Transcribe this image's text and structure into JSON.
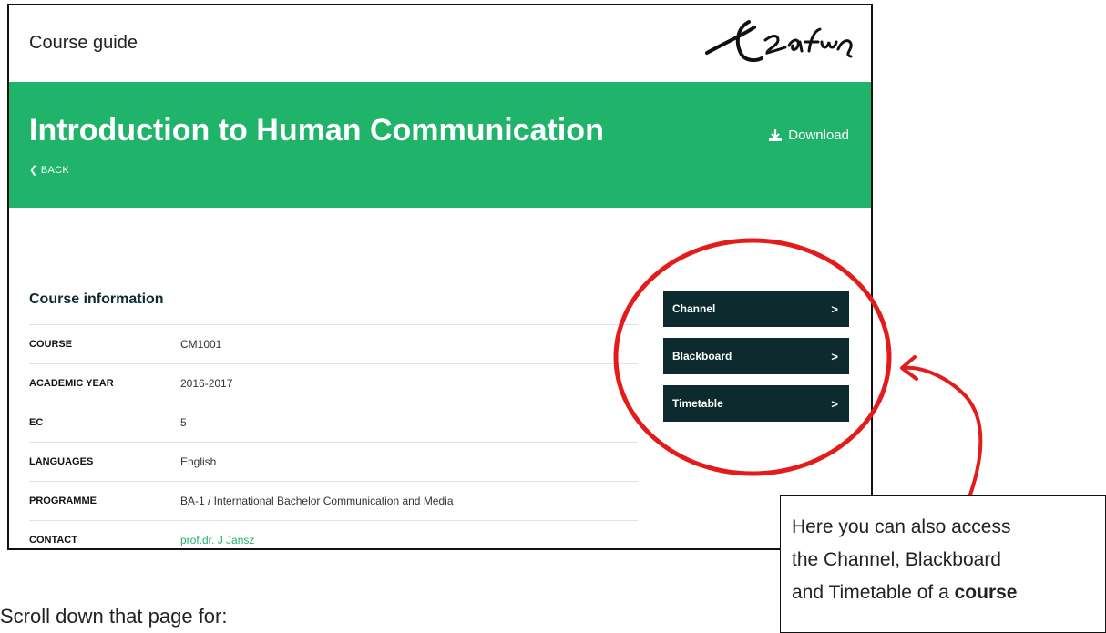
{
  "header": {
    "site_title": "Course guide",
    "logo_text": "Erasmus"
  },
  "hero": {
    "title": "Introduction to Human Communication",
    "back_label": "BACK",
    "download_label": "Download"
  },
  "course_info": {
    "title": "Course information",
    "rows": [
      {
        "label": "COURSE",
        "value": "CM1001"
      },
      {
        "label": "ACADEMIC YEAR",
        "value": "2016-2017"
      },
      {
        "label": "EC",
        "value": "5"
      },
      {
        "label": "LANGUAGES",
        "value": "English"
      },
      {
        "label": "PROGRAMME",
        "value": "BA-1 / International Bachelor Communication and Media"
      },
      {
        "label": "CONTACT",
        "value": "prof.dr. J Jansz"
      }
    ]
  },
  "side_buttons": [
    {
      "label": "Channel"
    },
    {
      "label": "Blackboard"
    },
    {
      "label": "Timetable"
    }
  ],
  "callout": {
    "line1": "Here you can also access",
    "line2": "the Channel, Blackboard",
    "line3_start": "and Timetable of a ",
    "line3_emph": "course"
  },
  "caption": "Scroll down that page for:",
  "colors": {
    "hero_green": "#1fb46a",
    "button_dark": "#0d2a2e",
    "annotation_red": "#e41b1b",
    "link_green": "#1fb46a"
  },
  "icons": [
    "download-icon",
    "chevron-left-icon",
    "chevron-right-icon",
    "erasmus-logo"
  ]
}
